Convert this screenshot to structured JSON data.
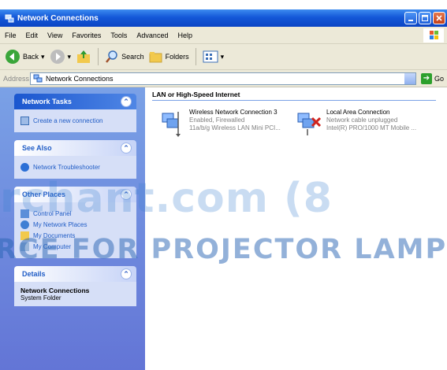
{
  "window": {
    "title": "Network Connections"
  },
  "menu": [
    "File",
    "Edit",
    "View",
    "Favorites",
    "Tools",
    "Advanced",
    "Help"
  ],
  "toolbar": {
    "back": "Back",
    "search": "Search",
    "folders": "Folders"
  },
  "address": {
    "label": "Address",
    "value": "Network Connections",
    "go": "Go"
  },
  "taskpane": {
    "network_tasks": {
      "title": "Network Tasks",
      "items": [
        "Create a new connection"
      ]
    },
    "see_also": {
      "title": "See Also",
      "items": [
        "Network Troubleshooter"
      ]
    },
    "other_places": {
      "title": "Other Places",
      "items": [
        "Control Panel",
        "My Network Places",
        "My Documents",
        "My Computer"
      ]
    },
    "details": {
      "title": "Details",
      "name": "Network Connections",
      "type": "System Folder"
    }
  },
  "content": {
    "group": "LAN or High-Speed Internet",
    "connections": [
      {
        "name": "Wireless Network Connection 3",
        "status": "Enabled, Firewalled",
        "device": "11a/b/g Wireless LAN Mini PCI..."
      },
      {
        "name": "Local Area Connection",
        "status": "Network cable unplugged",
        "device": "Intel(R) PRO/1000 MT Mobile ..."
      }
    ]
  },
  "watermark": {
    "line1": "rchant.com (8",
    "line2": "RCE FOR PROJECTOR LAMPS"
  },
  "colors": {
    "titlebar": "#1458d8",
    "taskpane": "#6f8fe0",
    "link": "#215dc6"
  }
}
